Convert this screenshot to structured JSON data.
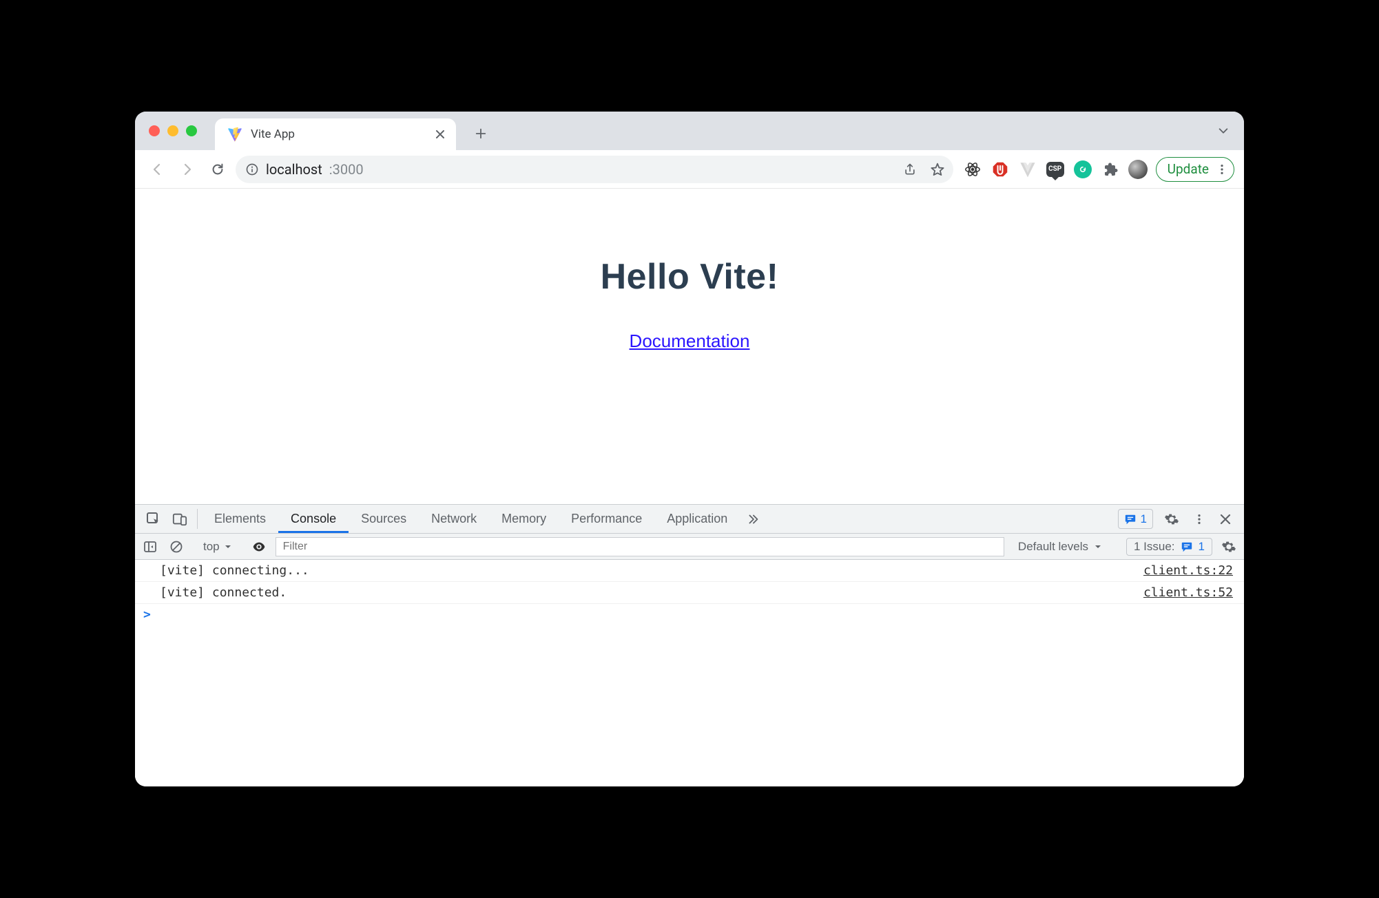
{
  "browser": {
    "tab_title": "Vite App",
    "url_host": "localhost",
    "url_port": ":3000",
    "update_label": "Update",
    "csp_text": "CSP"
  },
  "page": {
    "heading": "Hello Vite!",
    "doc_link_text": "Documentation"
  },
  "devtools": {
    "tabs": {
      "elements": "Elements",
      "console": "Console",
      "sources": "Sources",
      "network": "Network",
      "memory": "Memory",
      "performance": "Performance",
      "application": "Application"
    },
    "console_context": "top",
    "filter_placeholder": "Filter",
    "levels_label": "Default levels",
    "issue_label": "1 Issue:",
    "issue_count": "1",
    "msg_count": "1",
    "logs": [
      {
        "text": "[vite] connecting...",
        "source": "client.ts:22"
      },
      {
        "text": "[vite] connected.",
        "source": "client.ts:52"
      }
    ],
    "prompt_symbol": ">"
  }
}
